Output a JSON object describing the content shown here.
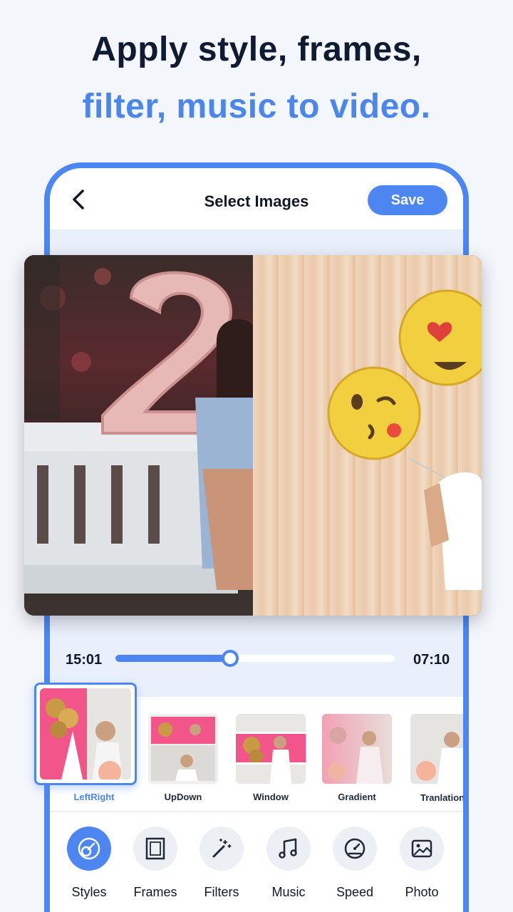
{
  "headline": {
    "line1": "Apply style, frames,",
    "line2": "filter, music to video."
  },
  "topbar": {
    "title": "Select Images",
    "save_label": "Save"
  },
  "timeline": {
    "current_time": "15:01",
    "total_time": "07:10",
    "progress": 0.41
  },
  "styles": [
    {
      "label": "LeftRight",
      "selected": true
    },
    {
      "label": "UpDown",
      "selected": false
    },
    {
      "label": "Window",
      "selected": false
    },
    {
      "label": "Gradient",
      "selected": false
    },
    {
      "label": "Tranlation",
      "selected": false
    }
  ],
  "tools": [
    {
      "label": "Styles",
      "icon": "styles-icon",
      "active": true
    },
    {
      "label": "Frames",
      "icon": "frame-icon",
      "active": false
    },
    {
      "label": "Filters",
      "icon": "magic-wand-icon",
      "active": false
    },
    {
      "label": "Music",
      "icon": "music-note-icon",
      "active": false
    },
    {
      "label": "Speed",
      "icon": "speedometer-icon",
      "active": false
    },
    {
      "label": "Photo",
      "icon": "photo-icon",
      "active": false
    }
  ],
  "colors": {
    "accent": "#4e86f1",
    "headline_dark": "#0f1a33",
    "headline_blue": "#4b86ee"
  }
}
